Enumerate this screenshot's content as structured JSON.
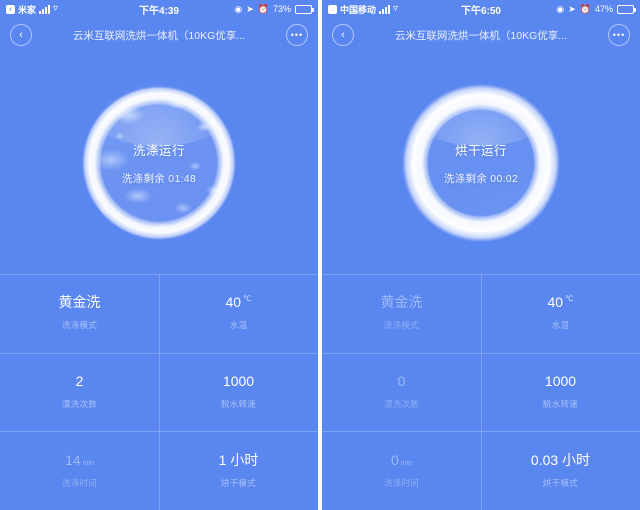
{
  "panels": [
    {
      "statusbar": {
        "app_badge": "‹",
        "carrier": "米家",
        "signal_icon": "signal-bars-icon",
        "wifi_icon": "wifi-icon",
        "time": "下午4:39",
        "location_icon": "location-icon",
        "navigation_icon": "navigation-arrow-icon",
        "alarm_icon": "alarm-clock-icon",
        "battery_percent": "73%",
        "battery_level": 73
      },
      "nav": {
        "back_icon": "‹",
        "title": "云米互联网洗烘一体机（10KG优享...",
        "more_icon": "•••"
      },
      "dial": {
        "title": "洗涤运行",
        "subtitle": "洗涤剩余 01:48",
        "drum_style": "suds"
      },
      "stats": [
        {
          "value": "黄金洗",
          "unit": "",
          "label": "洗涤模式",
          "dim": false
        },
        {
          "value": "40",
          "unit": "℃",
          "label": "水温",
          "dim": false
        },
        {
          "value": "2",
          "unit": "",
          "label": "漂洗次数",
          "dim": false
        },
        {
          "value": "1000",
          "unit": "",
          "label": "脱水转速",
          "dim": false
        },
        {
          "value": "14",
          "unit": "min",
          "label": "洗涤时间",
          "dim": true
        },
        {
          "value": "1 小时",
          "unit": "",
          "label": "烘干模式",
          "dim": false
        }
      ]
    },
    {
      "statusbar": {
        "app_badge": "",
        "carrier": "中国移动",
        "signal_icon": "signal-bars-icon",
        "wifi_icon": "wifi-icon",
        "time": "下午6:50",
        "location_icon": "location-icon",
        "navigation_icon": "navigation-arrow-icon",
        "alarm_icon": "alarm-clock-icon",
        "battery_percent": "47%",
        "battery_level": 47
      },
      "nav": {
        "back_icon": "‹",
        "title": "云米互联网洗烘一体机（10KG优享...",
        "more_icon": "•••"
      },
      "dial": {
        "title": "烘干运行",
        "subtitle": "洗涤剩余 00:02",
        "drum_style": "plain"
      },
      "stats": [
        {
          "value": "黄金洗",
          "unit": "",
          "label": "洗涤模式",
          "dim": true
        },
        {
          "value": "40",
          "unit": "℃",
          "label": "水温",
          "dim": false
        },
        {
          "value": "0",
          "unit": "",
          "label": "漂洗次数",
          "dim": true
        },
        {
          "value": "1000",
          "unit": "",
          "label": "脱水转速",
          "dim": false
        },
        {
          "value": "0",
          "unit": "min",
          "label": "洗涤时间",
          "dim": true
        },
        {
          "value": "0.03 小时",
          "unit": "",
          "label": "烘干模式",
          "dim": false
        }
      ]
    }
  ],
  "colors": {
    "background": "#5a86f0",
    "ring": "#ffffff",
    "label": "#a9c1f7",
    "dim": "#9dbaf6"
  }
}
